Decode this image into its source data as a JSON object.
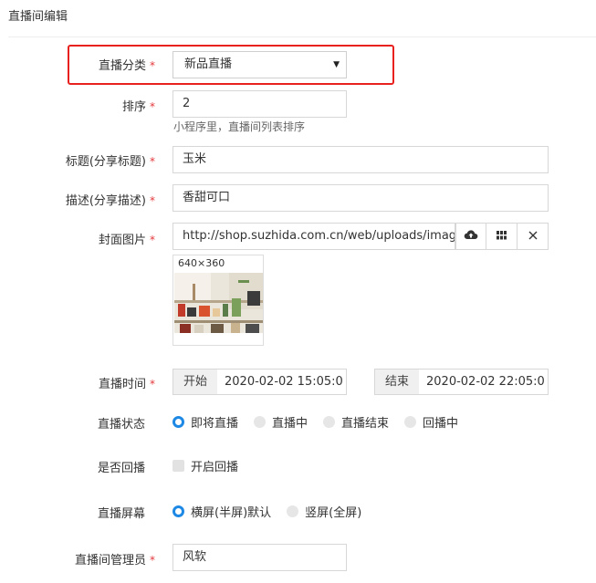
{
  "page_title": "直播间编辑",
  "required_mark": "*",
  "fields": {
    "category": {
      "label": "直播分类",
      "value": "新品直播"
    },
    "sort": {
      "label": "排序",
      "value": "2",
      "help": "小程序里，直播间列表排序"
    },
    "title": {
      "label": "标题(分享标题)",
      "value": "玉米"
    },
    "description": {
      "label": "描述(分享描述)",
      "value": "香甜可口"
    },
    "cover": {
      "label": "封面图片",
      "value": "http://shop.suzhida.com.cn/web/uploads/image",
      "size_hint": "640×360"
    },
    "time": {
      "label": "直播时间",
      "start_label": "开始",
      "start_value": "2020-02-02 15:05:0",
      "end_label": "结束",
      "end_value": "2020-02-02 22:05:0"
    },
    "status": {
      "label": "直播状态",
      "options": [
        "即将直播",
        "直播中",
        "直播结束",
        "回播中"
      ],
      "selected": 0
    },
    "replay": {
      "label": "是否回播",
      "checkbox_label": "开启回播",
      "checked": false
    },
    "screen": {
      "label": "直播屏幕",
      "options": [
        "横屏(半屏)默认",
        "竖屏(全屏)"
      ],
      "selected": 0
    },
    "admin": {
      "label": "直播间管理员",
      "value": "风软"
    }
  },
  "icons": {
    "upload": "cloud-upload-icon",
    "gallery": "grid-icon",
    "clear": "close-icon",
    "caret": "caret-down-icon"
  },
  "colors": {
    "required": "#e4393c",
    "highlight": "#e8211f",
    "radio_selected": "#1e88e5"
  }
}
